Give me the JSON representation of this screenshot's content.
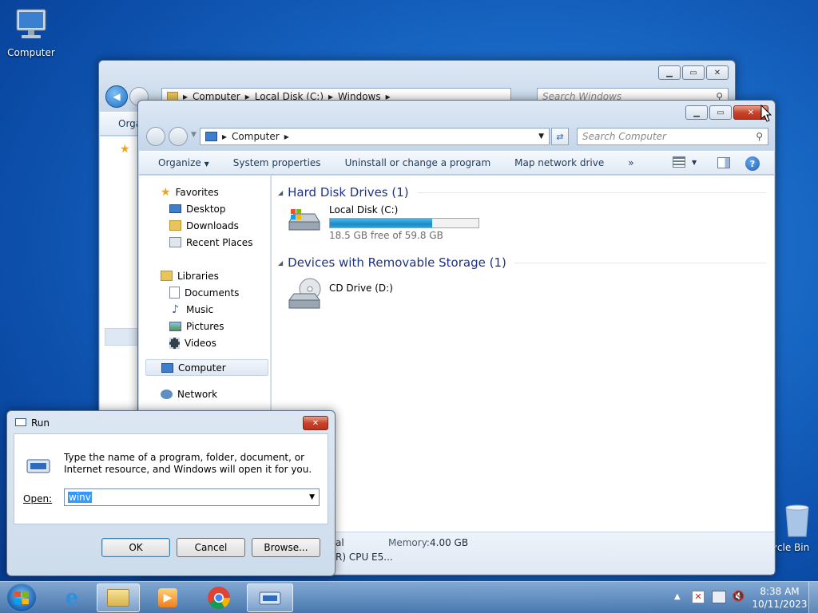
{
  "desktop": {
    "computer_label": "Computer",
    "recycle_label": "Recycle Bin"
  },
  "back_window": {
    "addr_parts": [
      "Computer",
      "Local Disk (C:)",
      "Windows"
    ],
    "search_placeholder": "Search Windows",
    "organize_partial": "Orga"
  },
  "explorer": {
    "address": "Computer",
    "search_placeholder": "Search Computer",
    "toolbar": {
      "organize": "Organize",
      "system_properties": "System properties",
      "uninstall": "Uninstall or change a program",
      "map_drive": "Map network drive",
      "more": "»"
    },
    "nav": {
      "favorites": "Favorites",
      "desktop": "Desktop",
      "downloads": "Downloads",
      "recent": "Recent Places",
      "libraries": "Libraries",
      "documents": "Documents",
      "music": "Music",
      "pictures": "Pictures",
      "videos": "Videos",
      "computer": "Computer",
      "network": "Network"
    },
    "groups": {
      "hdd": "Hard Disk Drives (1)",
      "removable": "Devices with Removable Storage (1)"
    },
    "local_disk": {
      "name": "Local Disk (C:)",
      "free": "18.5 GB free of 59.8 GB",
      "used_fraction": 0.69
    },
    "cd_drive": {
      "name": "CD Drive (D:)"
    },
    "details": {
      "memory_label": "Memory:",
      "memory_value": "4.00 GB",
      "partial_top": "al",
      "partial_bottom": "R) CPU E5..."
    }
  },
  "run": {
    "title": "Run",
    "description": "Type the name of a program, folder, document, or Internet resource, and Windows will open it for you.",
    "open_label": "Open:",
    "open_value": "winv",
    "ok": "OK",
    "cancel": "Cancel",
    "browse": "Browse..."
  },
  "taskbar": {
    "time": "8:38 AM",
    "date": "10/11/2023"
  },
  "colors": {
    "accent": "#1e3287",
    "progress": "#1c8cc9",
    "close": "#c7432a"
  }
}
